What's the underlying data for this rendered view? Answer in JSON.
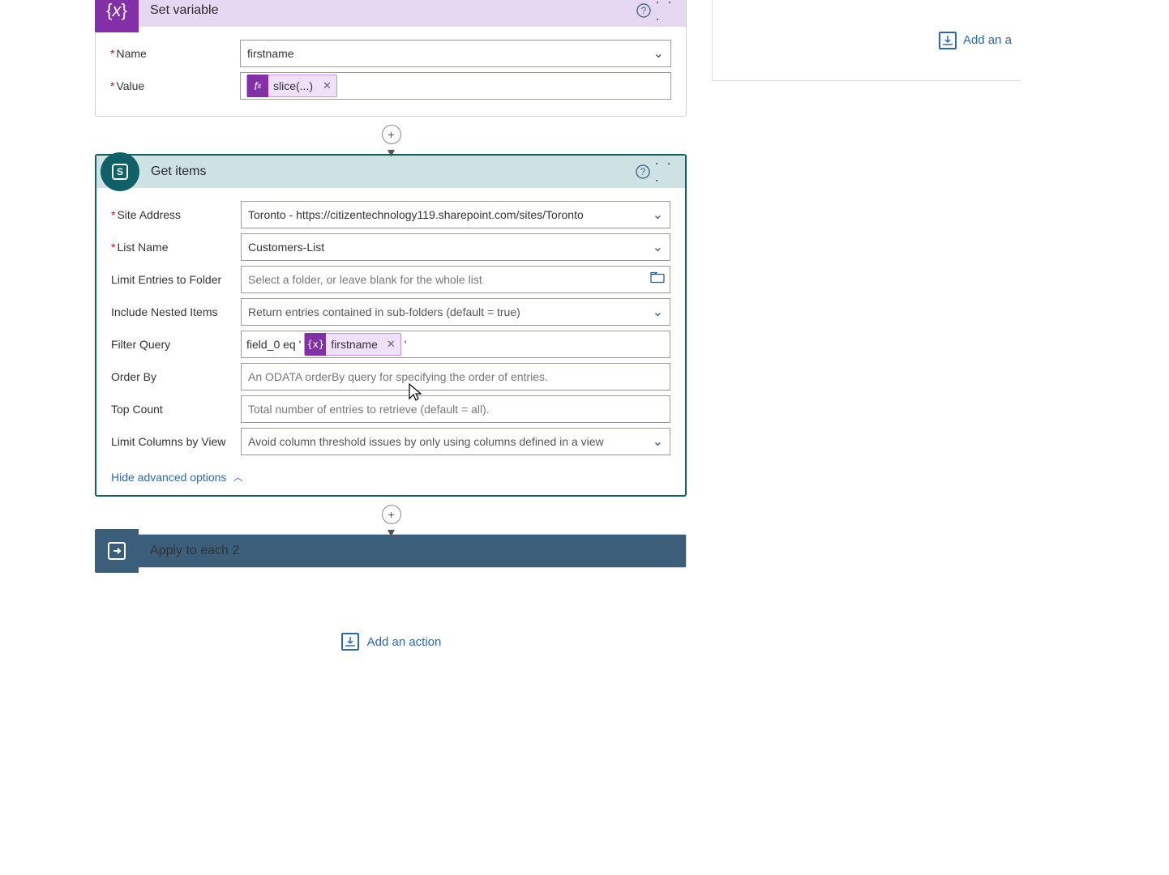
{
  "set_variable": {
    "title": "Set variable",
    "name_label": "Name",
    "name_value": "firstname",
    "value_label": "Value",
    "value_token": "slice(...)"
  },
  "get_items": {
    "title": "Get items",
    "site_address_label": "Site Address",
    "site_address_value": "Toronto - https://citizentechnology119.sharepoint.com/sites/Toronto",
    "list_name_label": "List Name",
    "list_name_value": "Customers-List",
    "limit_folder_label": "Limit Entries to Folder",
    "limit_folder_placeholder": "Select a folder, or leave blank for the whole list",
    "include_nested_label": "Include Nested Items",
    "include_nested_value": "Return entries contained in sub-folders (default = true)",
    "filter_query_label": "Filter Query",
    "filter_prefix": "field_0 eq '",
    "filter_token": "firstname",
    "filter_suffix": "'",
    "order_by_label": "Order By",
    "order_by_placeholder": "An ODATA orderBy query for specifying the order of entries.",
    "top_count_label": "Top Count",
    "top_count_placeholder": "Total number of entries to retrieve (default = all).",
    "limit_columns_label": "Limit Columns by View",
    "limit_columns_value": "Avoid column threshold issues by only using columns defined in a view",
    "hide_advanced": "Hide advanced options"
  },
  "apply_each": {
    "title": "Apply to each 2"
  },
  "add_action": "Add an action",
  "add_action_right": "Add an a"
}
